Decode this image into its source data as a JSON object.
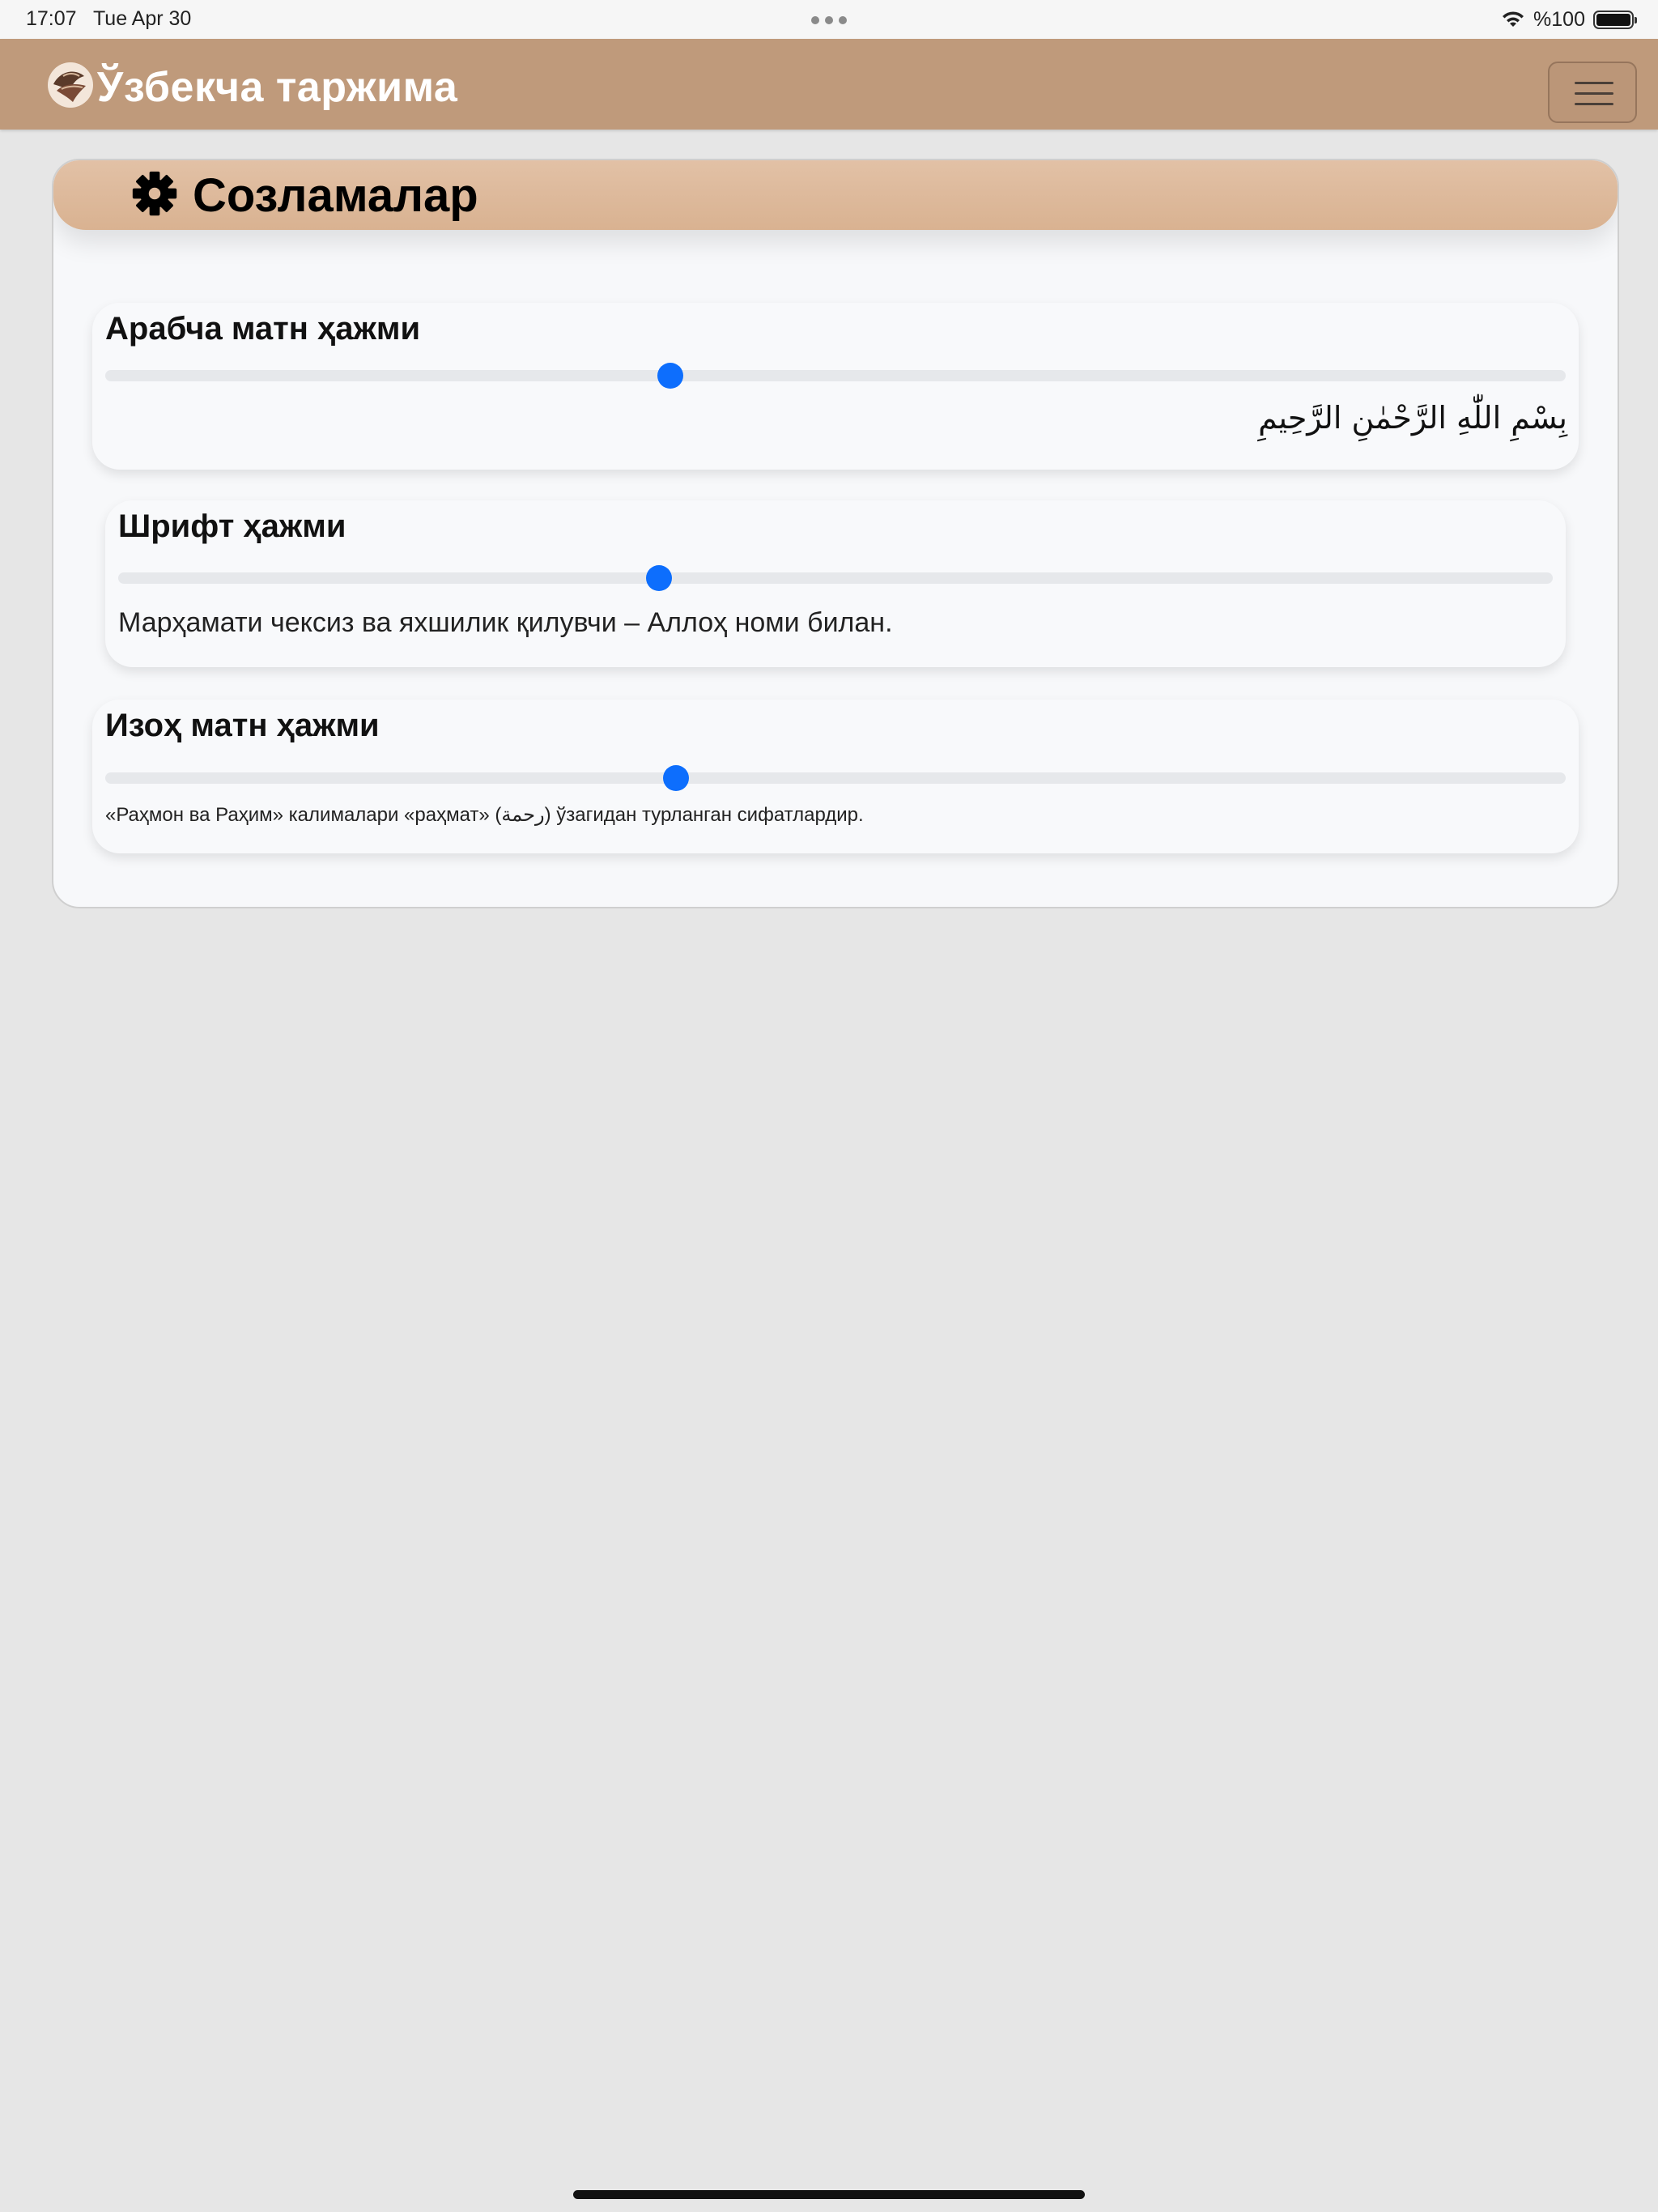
{
  "status_bar": {
    "time": "17:07",
    "date": "Tue Apr 30",
    "battery_text": "%100",
    "battery_level": 1.0
  },
  "navbar": {
    "brand": "Ўзбекча таржима",
    "logo_icon": "book-logo-icon",
    "menu_icon": "hamburger-icon"
  },
  "settings": {
    "title": "Созламалар",
    "title_icon": "gear-icon",
    "items": [
      {
        "label": "Арабча матн ҳажми",
        "value": 0.387,
        "sample": "بِسْمِ اللّٰهِ الرَّحْمٰنِ الرَّحِيمِ"
      },
      {
        "label": "Шрифт ҳажми",
        "value": 0.377,
        "sample": "Марҳамати чексиз ва яхшилик қилувчи – Аллоҳ номи билан."
      },
      {
        "label": "Изоҳ матн ҳажми",
        "value": 0.391,
        "sample": "«Раҳмон ва Раҳим» калималари «раҳмат» (رحمة) ўзагидан турланган сифатлардир."
      }
    ]
  },
  "colors": {
    "navbar": "#bf9a7b",
    "header": "#deba9d",
    "slider_thumb": "#0d6efd",
    "slider_track": "#e6e8eb",
    "background": "#e6e6e6"
  }
}
